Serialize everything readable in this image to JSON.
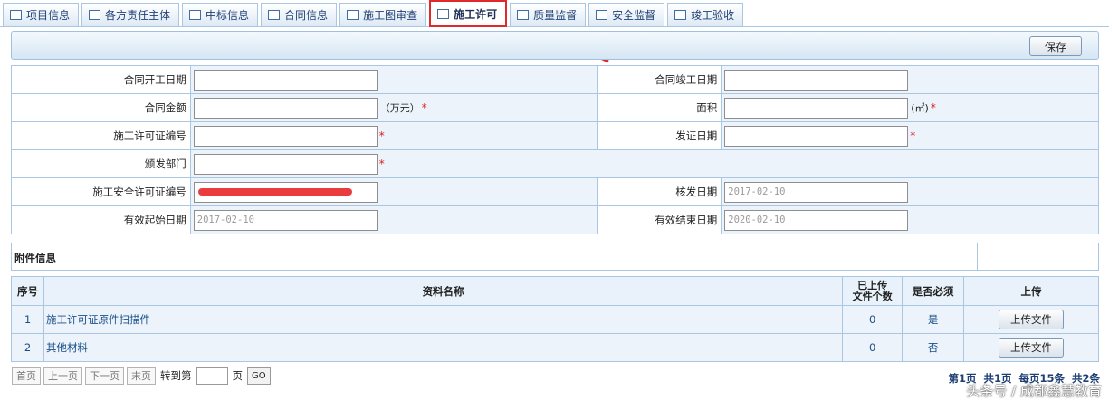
{
  "tabs": [
    {
      "label": "项目信息",
      "active": false
    },
    {
      "label": "各方责任主体",
      "active": false
    },
    {
      "label": "中标信息",
      "active": false
    },
    {
      "label": "合同信息",
      "active": false
    },
    {
      "label": "施工图审查",
      "active": false
    },
    {
      "label": "施工许可",
      "active": true
    },
    {
      "label": "质量监督",
      "active": false
    },
    {
      "label": "安全监督",
      "active": false
    },
    {
      "label": "竣工验收",
      "active": false
    }
  ],
  "toolbar": {
    "save_label": "保存"
  },
  "form": {
    "contract_start_label": "合同开工日期",
    "contract_start_value": "",
    "contract_end_label": "合同竣工日期",
    "contract_end_value": "",
    "contract_amount_label": "合同金额",
    "contract_amount_value": "",
    "contract_amount_unit": "（万元）",
    "area_label": "面积",
    "area_value": "",
    "area_unit": "(㎡)",
    "permit_no_label": "施工许可证编号",
    "permit_no_value": "",
    "issue_date_label": "发证日期",
    "issue_date_value": "",
    "issuer_label": "颁发部门",
    "issuer_value": "",
    "safety_permit_label": "施工安全许可证编号",
    "approve_date_label": "核发日期",
    "approve_date_value": "2017-02-10",
    "valid_start_label": "有效起始日期",
    "valid_start_value": "2017-02-10",
    "valid_end_label": "有效结束日期",
    "valid_end_value": "2020-02-10",
    "required_mark": "*"
  },
  "attachments": {
    "section_title": "附件信息",
    "headers": {
      "index": "序号",
      "name": "资料名称",
      "count": "已上传\n文件个数",
      "required": "是否必须",
      "upload": "上传"
    },
    "rows": [
      {
        "index": "1",
        "name": "施工许可证原件扫描件",
        "count": "0",
        "required": "是",
        "upload_label": "上传文件"
      },
      {
        "index": "2",
        "name": "其他材料",
        "count": "0",
        "required": "否",
        "upload_label": "上传文件"
      }
    ]
  },
  "pager": {
    "first": "首页",
    "prev": "上一页",
    "next": "下一页",
    "last": "末页",
    "goto_label": "转到第",
    "page_unit": "页",
    "go": "GO",
    "info": "第1页  共1页  每页15条  共2条"
  },
  "watermark": "头条号 / 成都鑫慧教育",
  "colors": {
    "accent_border": "#a9c6e3",
    "active_tab_border": "#e0292c",
    "required": "#e01b1b"
  }
}
